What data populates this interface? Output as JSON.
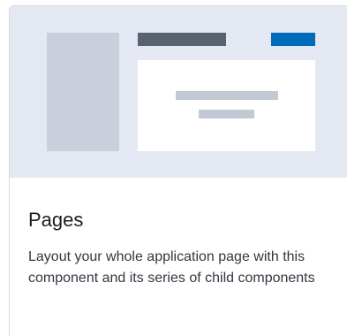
{
  "card": {
    "title": "Pages",
    "description": "Layout your whole application page with this component and its series of child components"
  },
  "colors": {
    "illustration_bg": "#e3e8f2",
    "sidebar": "#c9d0dc",
    "header_bar": "#5a6270",
    "header_button": "#006bb8",
    "content": "#ffffff",
    "content_lines": "#c3c9d4"
  }
}
